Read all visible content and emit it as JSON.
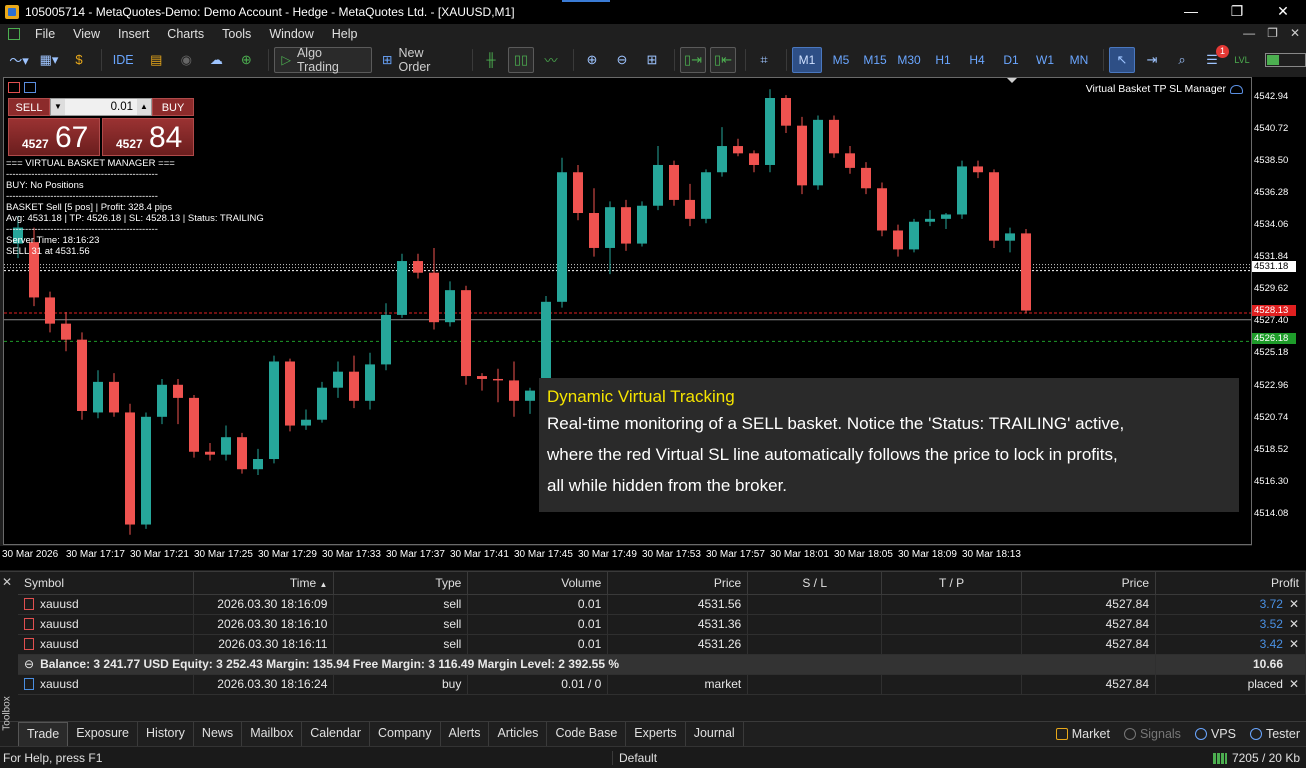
{
  "window": {
    "title": "105005714 - MetaQuotes-Demo: Demo Account - Hedge - MetaQuotes Ltd. - [XAUUSD,M1]",
    "controls": [
      "—",
      "❐",
      "✕"
    ]
  },
  "menu": {
    "items": [
      "File",
      "View",
      "Insert",
      "Charts",
      "Tools",
      "Window",
      "Help"
    ],
    "mdi_controls": [
      "—",
      "❐",
      "✕"
    ]
  },
  "toolbar": {
    "ide_label": "IDE",
    "algo_trading_label": "Algo Trading",
    "new_order_label": "New Order",
    "timeframes": [
      "M1",
      "M5",
      "M15",
      "M30",
      "H1",
      "H4",
      "D1",
      "W1",
      "MN"
    ],
    "active_timeframe": "M1",
    "notification_count": "1",
    "lvl_label": "LVL"
  },
  "chart": {
    "symbol": "XAUUSD",
    "timeframe": "M1",
    "ea_name": "Virtual Basket TP SL Manager",
    "one_click": {
      "sell_label": "SELL",
      "buy_label": "BUY",
      "lot": "0.01",
      "sell_small": "4527",
      "sell_big": "67",
      "buy_small": "4527",
      "buy_big": "84"
    },
    "overlay_lines": [
      "=== VIRTUAL BASKET MANAGER ===",
      "------------------------------------------------",
      "BUY: No Positions",
      "------------------------------------------------",
      "BASKET Sell [5 pos] | Profit: 328.4 pips",
      "Avg: 4531.18 | TP: 4526.18 | SL: 4528.13 | Status: TRAILING",
      "------------------------------------------------",
      "Server Time: 18:16:23",
      "SELL   31 at 4531.56"
    ],
    "info_box": {
      "title": "Dynamic Virtual Tracking",
      "lines": [
        "Real-time monitoring of a SELL basket. Notice the 'Status: TRAILING' active,",
        "where the red Virtual SL line automatically follows the price to lock in profits,",
        "all while hidden from the broker."
      ]
    },
    "price_labels": [
      "4542.94",
      "4540.72",
      "4538.50",
      "4536.28",
      "4534.06",
      "4531.84",
      "4529.62",
      "4527.40",
      "4525.18",
      "4522.96",
      "4520.74",
      "4518.52",
      "4516.30",
      "4514.08"
    ],
    "marker_labels": {
      "avg": "4531.18",
      "sl": "4528.13",
      "tp": "4526.18",
      "bid": "4527.67"
    },
    "time_labels": [
      "30 Mar 2026",
      "30 Mar 17:17",
      "30 Mar 17:21",
      "30 Mar 17:25",
      "30 Mar 17:29",
      "30 Mar 17:33",
      "30 Mar 17:37",
      "30 Mar 17:41",
      "30 Mar 17:45",
      "30 Mar 17:49",
      "30 Mar 17:53",
      "30 Mar 17:57",
      "30 Mar 18:01",
      "30 Mar 18:05",
      "30 Mar 18:09",
      "30 Mar 18:13"
    ],
    "colors": {
      "bull": "#26a69a",
      "bear": "#ef5350",
      "background": "#000000",
      "sl_line": "#e02020",
      "tp_line": "#1e9c2a"
    }
  },
  "chart_data": {
    "type": "candlestick",
    "title": "",
    "ylim": [
      4512.4,
      4544.0
    ],
    "candles": [
      {
        "o": 4532.9,
        "h": 4534.8,
        "l": 4531.9,
        "c": 4534.0
      },
      {
        "o": 4533.0,
        "h": 4534.0,
        "l": 4528.6,
        "c": 4529.2
      },
      {
        "o": 4529.2,
        "h": 4529.6,
        "l": 4526.8,
        "c": 4527.4
      },
      {
        "o": 4527.4,
        "h": 4528.2,
        "l": 4525.5,
        "c": 4526.3
      },
      {
        "o": 4526.3,
        "h": 4526.8,
        "l": 4520.8,
        "c": 4521.4
      },
      {
        "o": 4521.3,
        "h": 4524.2,
        "l": 4520.9,
        "c": 4523.4
      },
      {
        "o": 4523.4,
        "h": 4524.0,
        "l": 4521.0,
        "c": 4521.3
      },
      {
        "o": 4521.3,
        "h": 4521.9,
        "l": 4512.9,
        "c": 4513.6
      },
      {
        "o": 4513.6,
        "h": 4521.3,
        "l": 4513.3,
        "c": 4521.0
      },
      {
        "o": 4521.0,
        "h": 4523.6,
        "l": 4520.5,
        "c": 4523.2
      },
      {
        "o": 4523.2,
        "h": 4523.6,
        "l": 4520.5,
        "c": 4522.3
      },
      {
        "o": 4522.3,
        "h": 4522.5,
        "l": 4518.2,
        "c": 4518.6
      },
      {
        "o": 4518.6,
        "h": 4519.2,
        "l": 4518.0,
        "c": 4518.4
      },
      {
        "o": 4518.4,
        "h": 4520.4,
        "l": 4518.0,
        "c": 4519.6
      },
      {
        "o": 4519.6,
        "h": 4519.9,
        "l": 4517.1,
        "c": 4517.4
      },
      {
        "o": 4517.4,
        "h": 4518.8,
        "l": 4517.0,
        "c": 4518.1
      },
      {
        "o": 4518.1,
        "h": 4525.2,
        "l": 4517.8,
        "c": 4524.8
      },
      {
        "o": 4524.8,
        "h": 4525.0,
        "l": 4520.0,
        "c": 4520.4
      },
      {
        "o": 4520.4,
        "h": 4521.5,
        "l": 4520.1,
        "c": 4520.8
      },
      {
        "o": 4520.8,
        "h": 4523.4,
        "l": 4520.6,
        "c": 4523.0
      },
      {
        "o": 4523.0,
        "h": 4524.8,
        "l": 4522.3,
        "c": 4524.1
      },
      {
        "o": 4524.1,
        "h": 4525.2,
        "l": 4521.6,
        "c": 4522.1
      },
      {
        "o": 4522.1,
        "h": 4525.4,
        "l": 4521.5,
        "c": 4524.6
      },
      {
        "o": 4524.6,
        "h": 4528.8,
        "l": 4524.2,
        "c": 4528.0
      },
      {
        "o": 4528.0,
        "h": 4532.2,
        "l": 4527.8,
        "c": 4531.7
      },
      {
        "o": 4531.7,
        "h": 4532.2,
        "l": 4530.5,
        "c": 4530.9
      },
      {
        "o": 4530.9,
        "h": 4532.6,
        "l": 4527.0,
        "c": 4527.5
      },
      {
        "o": 4527.5,
        "h": 4530.3,
        "l": 4527.2,
        "c": 4529.7
      },
      {
        "o": 4529.7,
        "h": 4530.0,
        "l": 4523.2,
        "c": 4523.8
      },
      {
        "o": 4523.8,
        "h": 4524.0,
        "l": 4522.8,
        "c": 4523.6
      },
      {
        "o": 4523.6,
        "h": 4524.3,
        "l": 4522.0,
        "c": 4523.5
      },
      {
        "o": 4523.5,
        "h": 4524.8,
        "l": 4521.0,
        "c": 4522.1
      },
      {
        "o": 4522.1,
        "h": 4523.0,
        "l": 4521.2,
        "c": 4522.8
      },
      {
        "o": 4522.8,
        "h": 4529.3,
        "l": 4522.3,
        "c": 4528.9
      },
      {
        "o": 4528.9,
        "h": 4538.8,
        "l": 4528.5,
        "c": 4537.8
      },
      {
        "o": 4537.8,
        "h": 4538.3,
        "l": 4534.5,
        "c": 4535.0
      },
      {
        "o": 4535.0,
        "h": 4536.7,
        "l": 4532.0,
        "c": 4532.6
      },
      {
        "o": 4532.6,
        "h": 4535.8,
        "l": 4530.8,
        "c": 4535.4
      },
      {
        "o": 4535.4,
        "h": 4535.9,
        "l": 4532.4,
        "c": 4532.9
      },
      {
        "o": 4532.9,
        "h": 4535.8,
        "l": 4532.7,
        "c": 4535.5
      },
      {
        "o": 4535.5,
        "h": 4539.6,
        "l": 4535.2,
        "c": 4538.3
      },
      {
        "o": 4538.3,
        "h": 4538.6,
        "l": 4535.5,
        "c": 4535.9
      },
      {
        "o": 4535.9,
        "h": 4537.0,
        "l": 4534.1,
        "c": 4534.6
      },
      {
        "o": 4534.6,
        "h": 4538.0,
        "l": 4534.3,
        "c": 4537.8
      },
      {
        "o": 4537.8,
        "h": 4540.9,
        "l": 4537.5,
        "c": 4539.6
      },
      {
        "o": 4539.6,
        "h": 4540.1,
        "l": 4538.9,
        "c": 4539.1
      },
      {
        "o": 4539.1,
        "h": 4539.3,
        "l": 4537.8,
        "c": 4538.3
      },
      {
        "o": 4538.3,
        "h": 4543.5,
        "l": 4537.8,
        "c": 4542.9
      },
      {
        "o": 4542.9,
        "h": 4543.1,
        "l": 4540.5,
        "c": 4541.0
      },
      {
        "o": 4541.0,
        "h": 4541.6,
        "l": 4536.3,
        "c": 4536.9
      },
      {
        "o": 4536.9,
        "h": 4541.7,
        "l": 4536.6,
        "c": 4541.4
      },
      {
        "o": 4541.4,
        "h": 4541.7,
        "l": 4538.8,
        "c": 4539.1
      },
      {
        "o": 4539.1,
        "h": 4539.6,
        "l": 4537.7,
        "c": 4538.1
      },
      {
        "o": 4538.1,
        "h": 4538.5,
        "l": 4536.3,
        "c": 4536.7
      },
      {
        "o": 4536.7,
        "h": 4537.1,
        "l": 4533.4,
        "c": 4533.8
      },
      {
        "o": 4533.8,
        "h": 4534.2,
        "l": 4532.0,
        "c": 4532.5
      },
      {
        "o": 4532.5,
        "h": 4534.6,
        "l": 4532.3,
        "c": 4534.4
      },
      {
        "o": 4534.4,
        "h": 4535.2,
        "l": 4534.1,
        "c": 4534.6
      },
      {
        "o": 4534.6,
        "h": 4535.0,
        "l": 4533.9,
        "c": 4534.9
      },
      {
        "o": 4534.9,
        "h": 4538.6,
        "l": 4534.6,
        "c": 4538.2
      },
      {
        "o": 4538.2,
        "h": 4538.6,
        "l": 4537.4,
        "c": 4537.8
      },
      {
        "o": 4537.8,
        "h": 4538.0,
        "l": 4532.6,
        "c": 4533.1
      },
      {
        "o": 4533.1,
        "h": 4534.0,
        "l": 4532.3,
        "c": 4533.6
      },
      {
        "o": 4533.6,
        "h": 4533.9,
        "l": 4528.1,
        "c": 4528.3
      }
    ]
  },
  "trades": {
    "columns": [
      "Symbol",
      "Time",
      "Type",
      "Volume",
      "Price",
      "S / L",
      "T / P",
      "Price",
      "Profit"
    ],
    "sort_indicator": "▲",
    "rows": [
      {
        "symbol": "xauusd",
        "time": "2026.03.30 18:16:09",
        "type": "sell",
        "volume": "0.01",
        "price": "4531.56",
        "sl": "",
        "tp": "",
        "cur": "4527.84",
        "profit": "3.72"
      },
      {
        "symbol": "xauusd",
        "time": "2026.03.30 18:16:10",
        "type": "sell",
        "volume": "0.01",
        "price": "4531.36",
        "sl": "",
        "tp": "",
        "cur": "4527.84",
        "profit": "3.52"
      },
      {
        "symbol": "xauusd",
        "time": "2026.03.30 18:16:11",
        "type": "sell",
        "volume": "0.01",
        "price": "4531.26",
        "sl": "",
        "tp": "",
        "cur": "4527.84",
        "profit": "3.42"
      }
    ],
    "summary": {
      "text": "Balance: 3 241.77 USD  Equity: 3 252.43  Margin: 135.94  Free Margin: 3 116.49  Margin Level: 2 392.55 %",
      "profit": "10.66"
    },
    "order": {
      "symbol": "xauusd",
      "time": "2026.03.30 18:16:24",
      "type": "buy",
      "volume": "0.01 / 0",
      "price": "market",
      "cur": "4527.84",
      "status": "placed"
    }
  },
  "tabs": {
    "vertical_label": "Toolbox",
    "items": [
      "Trade",
      "Exposure",
      "History",
      "News",
      "Mailbox",
      "Calendar",
      "Company",
      "Alerts",
      "Articles",
      "Code Base",
      "Experts",
      "Journal"
    ],
    "active": "Trade",
    "right": [
      "Market",
      "Signals",
      "VPS",
      "Tester"
    ]
  },
  "status": {
    "help": "For Help, press F1",
    "profile": "Default",
    "network": "7205 / 20 Kb"
  }
}
